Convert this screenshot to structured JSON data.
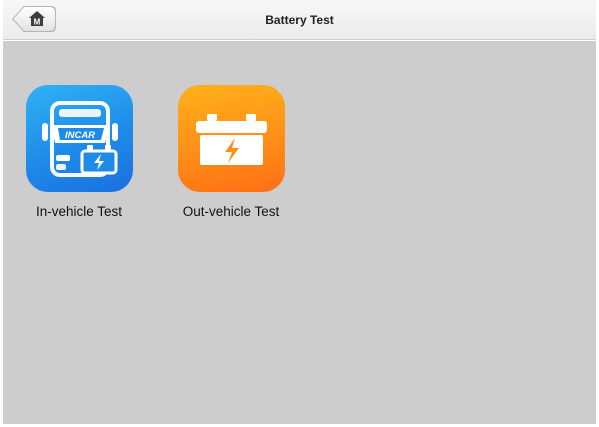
{
  "header": {
    "title": "Battery Test",
    "home_button_glyph": "M"
  },
  "apps": [
    {
      "label": "In-vehicle Test",
      "icon": "incar-battery-icon",
      "icon_text": "INCAR",
      "color": "#1f8be9"
    },
    {
      "label": "Out-vehicle Test",
      "icon": "battery-bolt-icon",
      "color": "#ff8f18"
    }
  ],
  "colors": {
    "content_bg": "#cdcdcd",
    "header_bg": "#f2f2f2"
  }
}
